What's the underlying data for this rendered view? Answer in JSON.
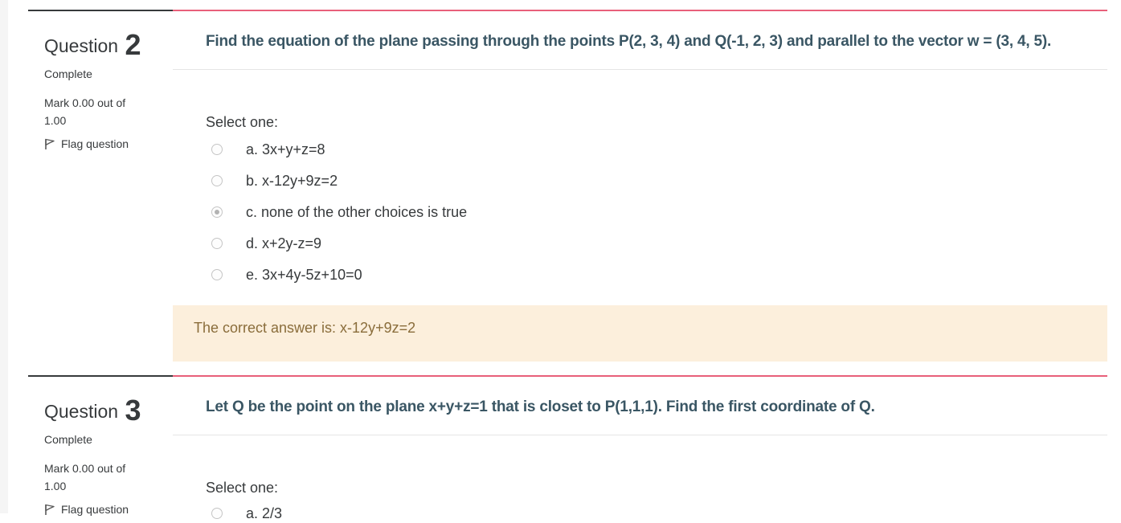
{
  "questions": [
    {
      "label": "Question",
      "number": "2",
      "state": "Complete",
      "grade": "Mark 0.00 out of 1.00",
      "flag_label": "Flag question",
      "text": "Find the equation of the plane passing through the points P(2, 3, 4) and Q(-1, 2, 3) and parallel to the vector w = (3, 4, 5).",
      "prompt": "Select one:",
      "options": [
        {
          "label": "a. 3x+y+z=8",
          "selected": false
        },
        {
          "label": "b. x-12y+9z=2",
          "selected": false
        },
        {
          "label": "c. none of the other choices is true",
          "selected": true
        },
        {
          "label": "d. x+2y-z=9",
          "selected": false
        },
        {
          "label": "e. 3x+4y-5z+10=0",
          "selected": false
        }
      ],
      "feedback": "The correct answer is: x-12y+9z=2"
    },
    {
      "label": "Question",
      "number": "3",
      "state": "Complete",
      "grade": "Mark 0.00 out of 1.00",
      "flag_label": "Flag question",
      "text": "Let Q be the point on the plane x+y+z=1 that is closet to P(1,1,1). Find the first coordinate of Q.",
      "prompt": "Select one:",
      "options": [
        {
          "label": "a. 2/3",
          "selected": false
        }
      ]
    }
  ],
  "colors": {
    "question_text": "#3a5664",
    "content_border": "#e8607a",
    "info_border": "#373a3c",
    "feedback_bg": "#fcefdc",
    "feedback_text": "#8a6d3b"
  }
}
